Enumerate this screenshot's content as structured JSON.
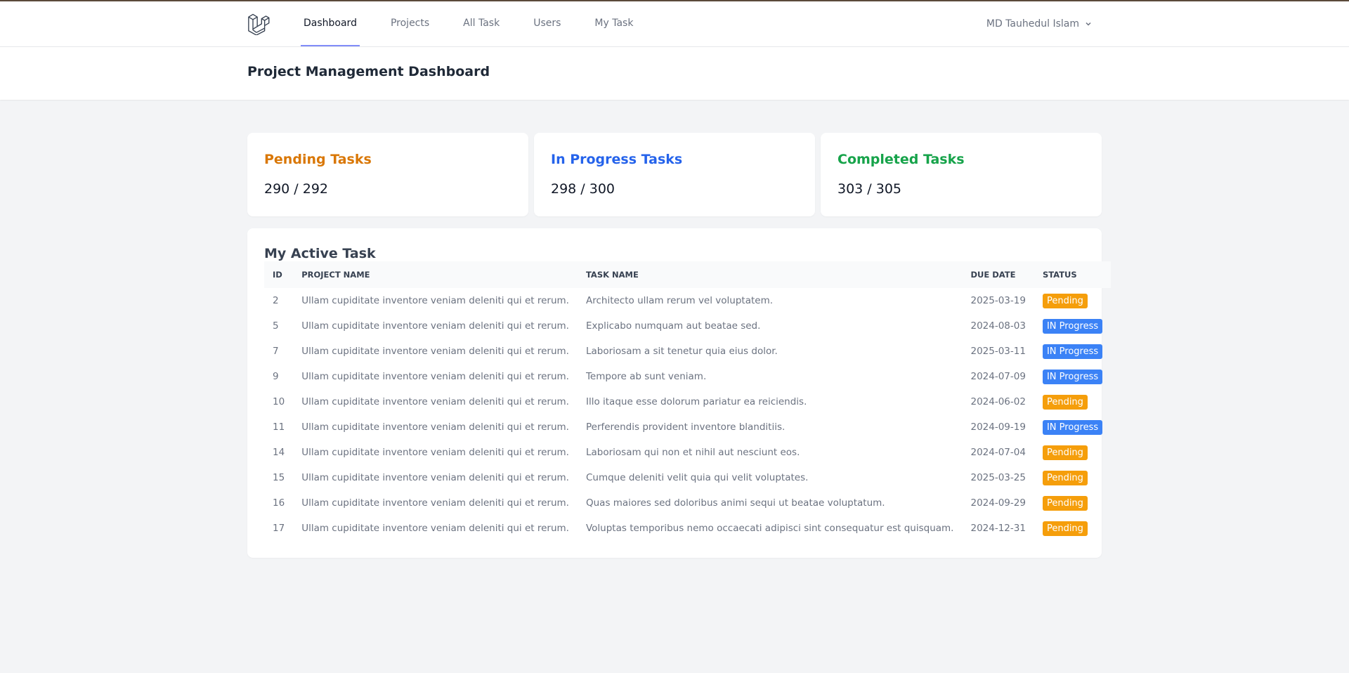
{
  "nav": {
    "links": [
      "Dashboard",
      "Projects",
      "All Task",
      "Users",
      "My Task"
    ],
    "active": 0,
    "user_name": "MD Tauhedul Islam"
  },
  "header": {
    "title": "Project Management Dashboard"
  },
  "stats": [
    {
      "label": "Pending Tasks",
      "value": "290 /  292",
      "color": "#d97706"
    },
    {
      "label": "In Progress Tasks",
      "value": "298 /  300",
      "color": "#2563eb"
    },
    {
      "label": "Completed Tasks",
      "value": "303 /  305",
      "color": "#16a34a"
    }
  ],
  "active_tasks": {
    "title": "My Active Task",
    "columns": [
      "ID",
      "PROJECT NAME",
      "TASK NAME",
      "DUE DATE",
      "STATUS"
    ],
    "rows": [
      {
        "id": "2",
        "project": "Ullam cupiditate inventore veniam deleniti qui et rerum.",
        "task": "Architecto ullam rerum vel voluptatem.",
        "due": "2025-03-19",
        "status": "Pending"
      },
      {
        "id": "5",
        "project": "Ullam cupiditate inventore veniam deleniti qui et rerum.",
        "task": "Explicabo numquam aut beatae sed.",
        "due": "2024-08-03",
        "status": "IN Progress"
      },
      {
        "id": "7",
        "project": "Ullam cupiditate inventore veniam deleniti qui et rerum.",
        "task": "Laboriosam a sit tenetur quia eius dolor.",
        "due": "2025-03-11",
        "status": "IN Progress"
      },
      {
        "id": "9",
        "project": "Ullam cupiditate inventore veniam deleniti qui et rerum.",
        "task": "Tempore ab sunt veniam.",
        "due": "2024-07-09",
        "status": "IN Progress"
      },
      {
        "id": "10",
        "project": "Ullam cupiditate inventore veniam deleniti qui et rerum.",
        "task": "Illo itaque esse dolorum pariatur ea reiciendis.",
        "due": "2024-06-02",
        "status": "Pending"
      },
      {
        "id": "11",
        "project": "Ullam cupiditate inventore veniam deleniti qui et rerum.",
        "task": "Perferendis provident inventore blanditiis.",
        "due": "2024-09-19",
        "status": "IN Progress"
      },
      {
        "id": "14",
        "project": "Ullam cupiditate inventore veniam deleniti qui et rerum.",
        "task": "Laboriosam qui non et nihil aut nesciunt eos.",
        "due": "2024-07-04",
        "status": "Pending"
      },
      {
        "id": "15",
        "project": "Ullam cupiditate inventore veniam deleniti qui et rerum.",
        "task": "Cumque deleniti velit quia qui velit voluptates.",
        "due": "2025-03-25",
        "status": "Pending"
      },
      {
        "id": "16",
        "project": "Ullam cupiditate inventore veniam deleniti qui et rerum.",
        "task": "Quas maiores sed doloribus animi sequi ut beatae voluptatum.",
        "due": "2024-09-29",
        "status": "Pending"
      },
      {
        "id": "17",
        "project": "Ullam cupiditate inventore veniam deleniti qui et rerum.",
        "task": "Voluptas temporibus nemo occaecati adipisci sint consequatur est quisquam.",
        "due": "2024-12-31",
        "status": "Pending"
      }
    ]
  },
  "status_colors": {
    "Pending": "#f59e0b",
    "IN Progress": "#3b82f6"
  },
  "icons": {
    "logo": "laravel-logo-icon",
    "user_menu": "chevron-down-icon"
  }
}
